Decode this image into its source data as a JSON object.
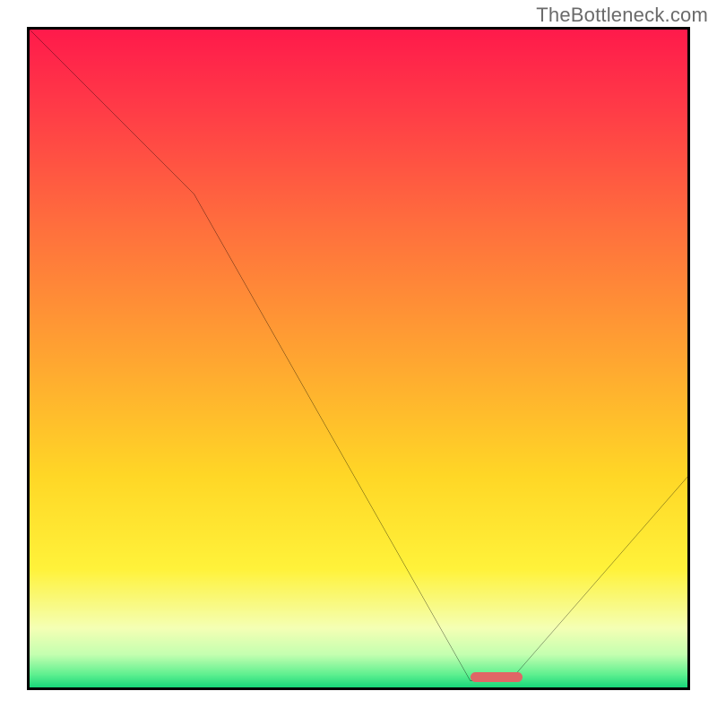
{
  "watermark": "TheBottleneck.com",
  "chart_data": {
    "type": "line",
    "title": "",
    "xlabel": "",
    "ylabel": "",
    "xlim": [
      0,
      100
    ],
    "ylim": [
      0,
      100
    ],
    "series": [
      {
        "name": "curve",
        "x": [
          0,
          25,
          67,
          73,
          100
        ],
        "y": [
          100,
          75,
          1,
          1,
          32
        ]
      }
    ],
    "marker": {
      "x_start": 67,
      "x_end": 75,
      "y": 0.8
    },
    "gradient_stops": [
      {
        "pct": 0,
        "color": "#ff1a4b"
      },
      {
        "pct": 12,
        "color": "#ff3b47"
      },
      {
        "pct": 30,
        "color": "#ff6f3d"
      },
      {
        "pct": 50,
        "color": "#ffa531"
      },
      {
        "pct": 68,
        "color": "#ffd726"
      },
      {
        "pct": 82,
        "color": "#fff23a"
      },
      {
        "pct": 91,
        "color": "#f4ffb4"
      },
      {
        "pct": 95,
        "color": "#c4ffb0"
      },
      {
        "pct": 98,
        "color": "#60f090"
      },
      {
        "pct": 100,
        "color": "#18d77a"
      }
    ]
  }
}
